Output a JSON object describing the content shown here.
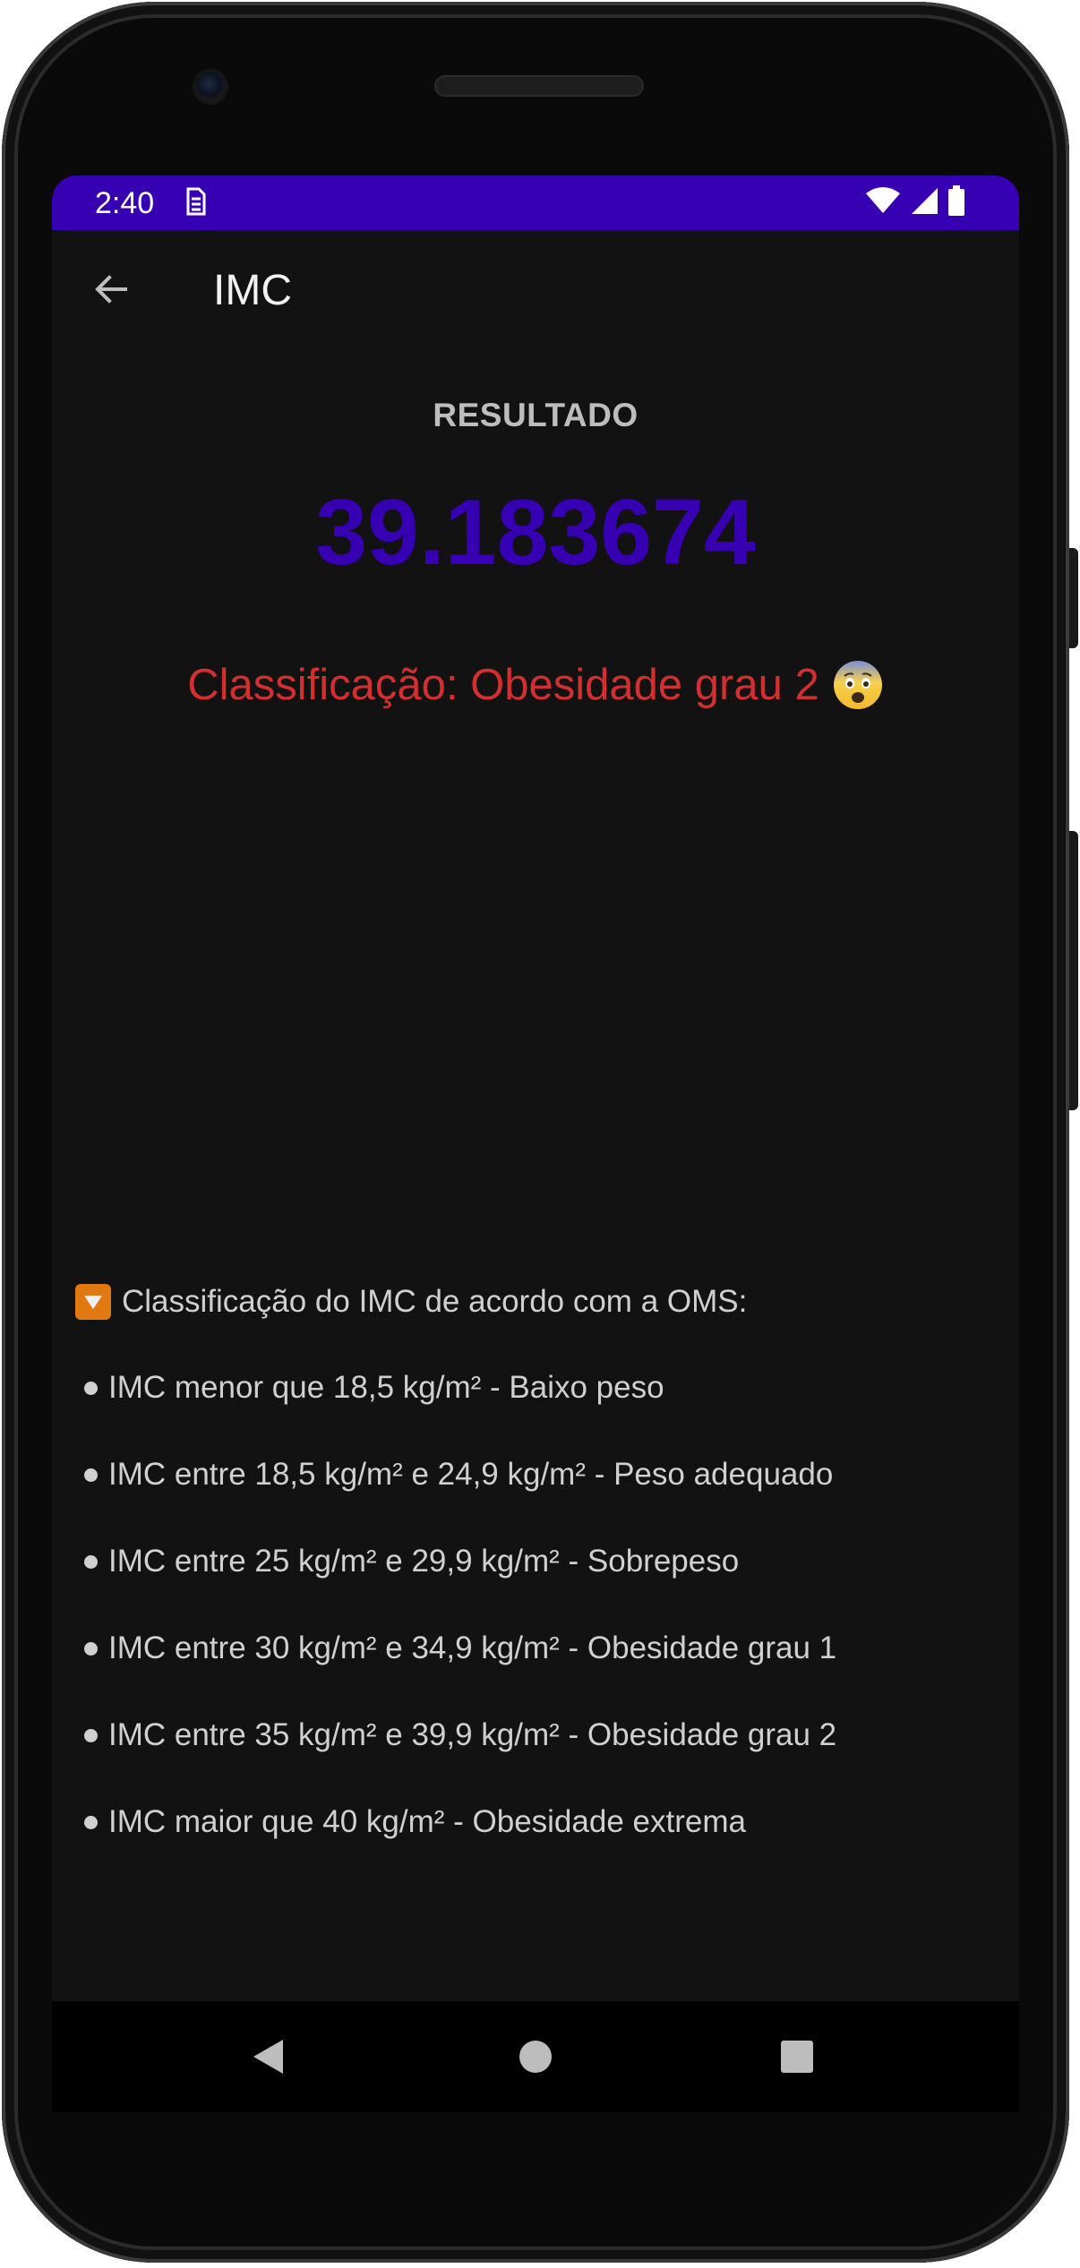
{
  "status_bar": {
    "time": "2:40",
    "notification_icon": "sim-card-icon",
    "icons": [
      "wifi-icon",
      "signal-icon",
      "battery-icon"
    ]
  },
  "app_bar": {
    "title": "IMC",
    "back_icon": "arrow-back-icon"
  },
  "result": {
    "label": "RESULTADO",
    "value": "39.183674",
    "classification": "Classificação: Obesidade grau 2",
    "emoji": "fearful-face-icon"
  },
  "info": {
    "title": "Classificação do IMC de acordo com a OMS:",
    "items": [
      "IMC menor que 18,5 kg/m² - Baixo peso",
      "IMC entre 18,5 kg/m² e 24,9 kg/m² - Peso adequado",
      "IMC entre 25 kg/m² e 29,9 kg/m² - Sobrepeso",
      "IMC entre 30 kg/m² e 34,9 kg/m² - Obesidade grau 1",
      "IMC entre 35 kg/m² e 39,9 kg/m² - Obesidade grau 2",
      "IMC maior que 40 kg/m² - Obesidade extrema"
    ]
  },
  "nav_bar": {
    "buttons": [
      "back-triangle-icon",
      "home-circle-icon",
      "recents-square-icon"
    ]
  },
  "colors": {
    "status_bar": "#3700b3",
    "result_value": "#3700b3",
    "classification": "#d32f2f",
    "background": "#121212"
  }
}
